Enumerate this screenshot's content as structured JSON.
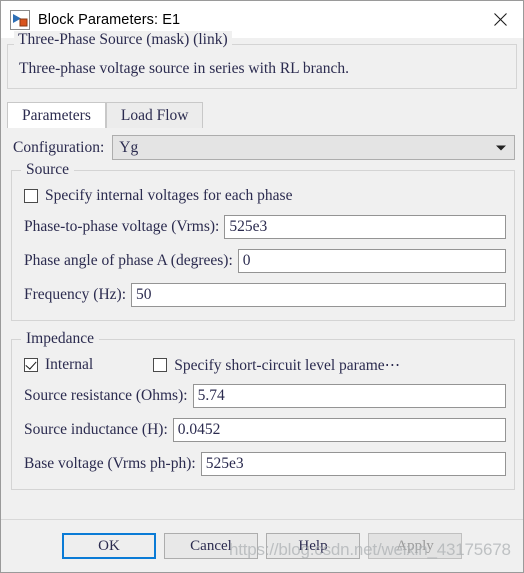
{
  "window": {
    "title": "Block Parameters: E1",
    "icon": "simulink-block-icon",
    "close_icon": "close-icon"
  },
  "description": {
    "heading": "Three-Phase Source (mask) (link)",
    "body": "Three-phase voltage source in series with RL branch."
  },
  "tabs": [
    {
      "label": "Parameters",
      "active": true
    },
    {
      "label": "Load Flow",
      "active": false
    }
  ],
  "configuration": {
    "label": "Configuration:",
    "value": "Yg",
    "arrow_icon": "chevron-down-icon"
  },
  "source_group": {
    "legend": "Source",
    "specify_internal": {
      "label": "Specify internal voltages for each phase",
      "checked": false
    },
    "fields": [
      {
        "label": "Phase-to-phase voltage (Vrms):",
        "value": "525e3"
      },
      {
        "label": "Phase angle of phase A (degrees):",
        "value": "0"
      },
      {
        "label": "Frequency (Hz):",
        "value": "50"
      }
    ]
  },
  "impedance_group": {
    "legend": "Impedance",
    "internal": {
      "label": "Internal",
      "checked": true
    },
    "short_circuit": {
      "label": "Specify short-circuit level parame⋯",
      "checked": false
    },
    "fields": [
      {
        "label": "Source resistance (Ohms):",
        "value": "5.74"
      },
      {
        "label": "Source inductance (H):",
        "value": "0.0452"
      },
      {
        "label": "Base voltage (Vrms ph-ph):",
        "value": "525e3"
      }
    ]
  },
  "buttons": [
    {
      "label": "OK",
      "style": "primary"
    },
    {
      "label": "Cancel",
      "style": "normal"
    },
    {
      "label": "Help",
      "style": "normal"
    },
    {
      "label": "Apply",
      "style": "disabled"
    }
  ],
  "watermark": {
    "text": "https://blog.csdn.net/weixin_43175678"
  },
  "colors": {
    "accent": "#0a7bd6",
    "text": "#2b2b4f",
    "window_bg": "#f0f0f0",
    "titlebar_bg": "#ffffff"
  }
}
